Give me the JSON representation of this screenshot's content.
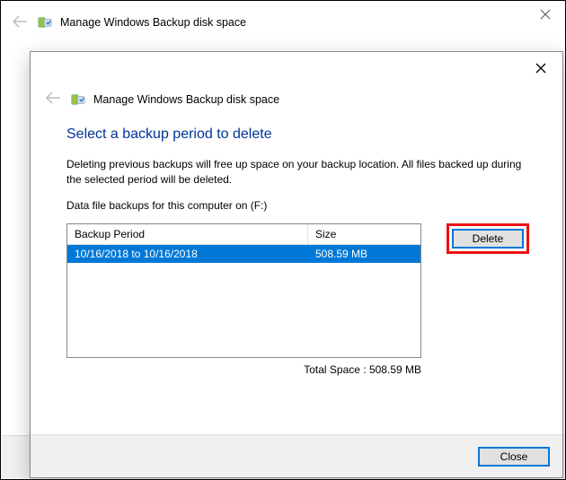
{
  "parent": {
    "title": "Manage Windows Backup disk space"
  },
  "dialog": {
    "title": "Manage Windows Backup disk space",
    "heading": "Select a backup period to delete",
    "description": "Deleting previous backups will free up space on your backup location. All files backed up during the selected period will be deleted.",
    "subline": "Data file backups for this computer on (F:)",
    "columns": {
      "period": "Backup Period",
      "size": "Size"
    },
    "rows": [
      {
        "period": "10/16/2018 to 10/16/2018",
        "size": "508.59 MB"
      }
    ],
    "total_label": "Total Space : 508.59 MB",
    "delete_label": "Delete",
    "close_label": "Close"
  }
}
